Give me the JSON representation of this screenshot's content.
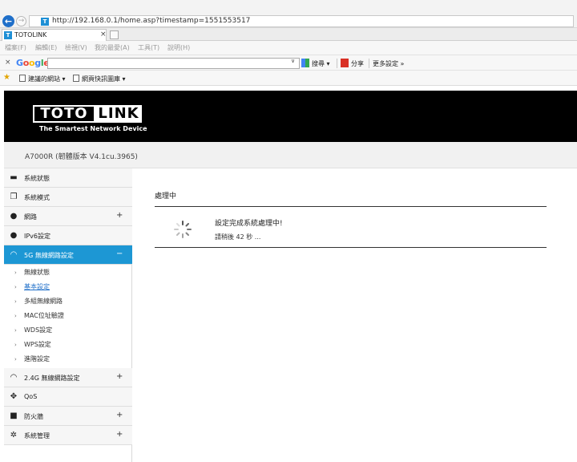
{
  "browser": {
    "url": "http://192.168.0.1/home.asp?timestamp=1551553517",
    "favicon": "T",
    "tab_title": "TOTOLINK",
    "tab_close": "×",
    "menu": [
      "檔案(F)",
      "編輯(E)",
      "檢視(V)",
      "我的最愛(A)",
      "工具(T)",
      "說明(H)"
    ],
    "google_bar": {
      "close": "×",
      "logo_letters": [
        "G",
        "o",
        "o",
        "g",
        "l",
        "e"
      ],
      "logo_colors": [
        "#4285f4",
        "#ea4335",
        "#fbbc05",
        "#4285f4",
        "#34a853",
        "#ea4335"
      ],
      "dropdown": "∨",
      "search_label": "搜尋 ▾",
      "share_label": "分享",
      "more_label": "更多設定 »"
    },
    "favorites": {
      "suggested": "建議的網站 ▾",
      "web_slice": "網頁快訊圖庫 ▾"
    }
  },
  "app": {
    "logo_left": "TOTO",
    "logo_right": "LINK",
    "tagline": "The Smartest Network Device",
    "firmware": "A7000R (韌體版本 V4.1cu.3965)",
    "accent_color": "#1d97d4"
  },
  "sidebar": {
    "items": [
      {
        "label": "系統狀態",
        "icon": "chat-icon",
        "glyph": "▬",
        "plus": ""
      },
      {
        "label": "系統模式",
        "icon": "windows-icon",
        "glyph": "❐",
        "plus": ""
      },
      {
        "label": "網路",
        "icon": "globe-icon",
        "glyph": "●",
        "plus": "+"
      },
      {
        "label": "IPv6設定",
        "icon": "ipv6-icon",
        "glyph": "●",
        "plus": ""
      },
      {
        "label": "5G 無線網路設定",
        "icon": "wifi-icon",
        "glyph": "◠",
        "plus": "−"
      },
      {
        "label": "2.4G 無線網路設定",
        "icon": "wifi-icon",
        "glyph": "◠",
        "plus": "+"
      },
      {
        "label": "QoS",
        "icon": "qos-icon",
        "glyph": "✥",
        "plus": ""
      },
      {
        "label": "防火牆",
        "icon": "lock-icon",
        "glyph": "■",
        "plus": "+"
      },
      {
        "label": "系統管理",
        "icon": "gear-icon",
        "glyph": "✲",
        "plus": "+"
      }
    ],
    "submenu": [
      {
        "label": "無線狀態"
      },
      {
        "label": "基本設定"
      },
      {
        "label": "多組無線網路"
      },
      {
        "label": "MAC位址驗證"
      },
      {
        "label": "WDS設定"
      },
      {
        "label": "WPS設定"
      },
      {
        "label": "進階設定"
      }
    ],
    "bullet": "›"
  },
  "main": {
    "section_title": "處理中",
    "message": "設定完成系統處理中!",
    "wait": "請稍後 42 秒 ..."
  }
}
